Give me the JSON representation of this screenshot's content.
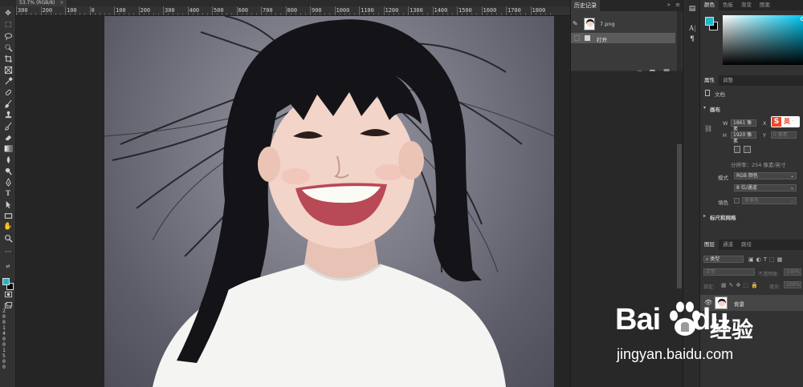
{
  "document": {
    "tab_title": "53.7% (RGB/8)",
    "tab_close": "×",
    "ruler_labels": [
      "300",
      "200",
      "100",
      "0",
      "100",
      "200",
      "300",
      "400",
      "500",
      "600",
      "700",
      "800",
      "900",
      "1000",
      "1100",
      "1200",
      "1300",
      "1400",
      "1500",
      "1600",
      "1700",
      "1800"
    ],
    "vruler_labels": [
      "2",
      "0",
      "0",
      "1",
      "4",
      "0",
      "0",
      "1",
      "5",
      "0",
      "0"
    ]
  },
  "history_panel": {
    "tab": "历史记录",
    "collapse": "»",
    "menu": "≡",
    "snapshot_name": "7.png",
    "state_label": "打开",
    "footer_icons": [
      "new-document-from-state-icon",
      "camera-icon",
      "trash-icon"
    ]
  },
  "color_panel": {
    "tabs": [
      "颜色",
      "色板",
      "渐变",
      "图案"
    ],
    "foreground": "#1fb7c9",
    "background": "#000000"
  },
  "properties_panel": {
    "tabs": [
      "属性",
      "调整"
    ],
    "doc_label": "文档",
    "canvas_section": "画布",
    "width_label": "W",
    "width_value": "1861 像素",
    "x_label": "X",
    "height_label": "H",
    "height_value": "1920 像素",
    "y_label": "Y",
    "y_value": "0 像素",
    "resolution": "分辨率：254 像素/英寸",
    "mode_label": "模式",
    "mode_value": "RGB 颜色",
    "depth_value": "8 位/通道",
    "fill_label": "填色",
    "fill_value": "背景色",
    "rulers_section": "标尺和网格",
    "ime_badge": "英"
  },
  "layers_panel": {
    "tabs": [
      "图层",
      "通道",
      "路径"
    ],
    "filter_kind": "类型",
    "blend_mode": "正常",
    "opacity_label": "不透明度:",
    "opacity_value": "100%",
    "lock_label": "锁定:",
    "fill_label": "填充:",
    "fill_value": "100%",
    "layer_name": "背景"
  },
  "watermark": {
    "brand": "Bai",
    "brand_suffix": "du",
    "cn": "经验",
    "url": "jingyan.baidu.com"
  },
  "colors": {
    "accent": "#1fb7c9",
    "panel_bg": "#323232",
    "selected_row": "#5b5b5b"
  }
}
